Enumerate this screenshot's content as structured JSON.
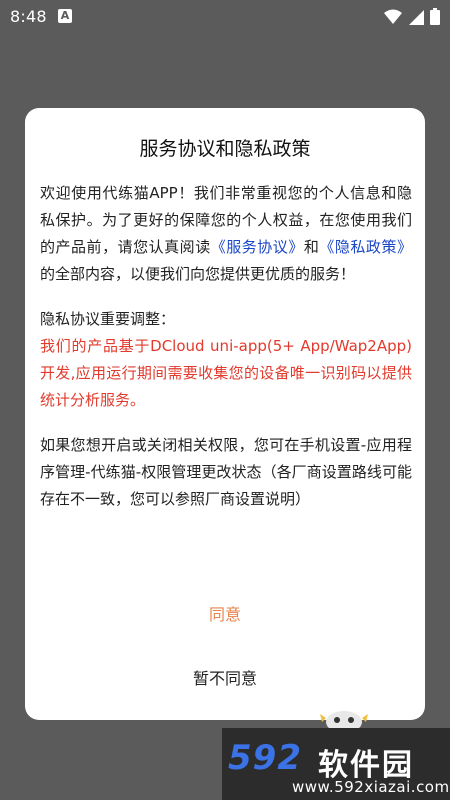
{
  "status_bar": {
    "time": "8:48",
    "badge": "A",
    "icons": [
      "wifi-icon",
      "signal-icon",
      "battery-icon"
    ]
  },
  "dialog": {
    "title": "服务协议和隐私政策",
    "para1_part1": "欢迎使用代练猫APP！我们非常重视您的个人信息和隐私保护。为了更好的保障您的个人权益，在您使用我们的产品前，请您认真阅读",
    "link_service": "《服务协议》",
    "para1_and": "和",
    "link_privacy": "《隐私政策》",
    "para1_part2": "的全部内容，以便我们向您提供更优质的服务！",
    "para2_heading": "隐私协议重要调整：",
    "para2_red": "我们的产品基于DCloud uni-app(5+ App/Wap2App)开发,应用运行期间需要收集您的设备唯一识别码以提供统计分析服务。",
    "para3": "如果您想开启或关闭相关权限，您可在手机设置-应用程序管理-代练猫-权限管理更改状态（各厂商设置路线可能存在不一致，您可以参照厂商设置说明）",
    "agree_label": "同意",
    "disagree_label": "暂不同意"
  },
  "watermark": {
    "logo": "592",
    "name": "软件园",
    "url": "www.592xiazai.com"
  },
  "colors": {
    "link": "#1a46c8",
    "red": "#e23a2c",
    "agree": "#e8834a",
    "overlay": "#5b5b5b"
  }
}
